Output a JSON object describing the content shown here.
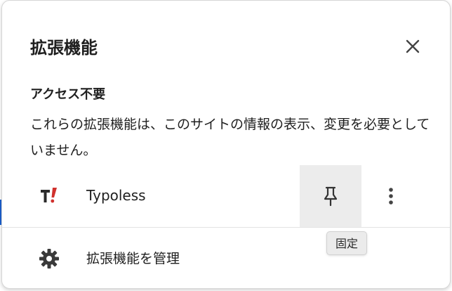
{
  "panel": {
    "title": "拡張機能",
    "close_icon": "close-icon"
  },
  "section": {
    "heading": "アクセス不要",
    "description": "これらの拡張機能は、このサイトの情報の表示、変更を必要としていません。"
  },
  "extension": {
    "name": "Typoless",
    "icon": "typoless-logo",
    "pin_icon": "pin-icon",
    "more_icon": "more-vertical-icon",
    "tooltip": "固定"
  },
  "manage": {
    "label": "拡張機能を管理",
    "icon": "gear-icon"
  },
  "colors": {
    "logo_dark": "#2b2b2b",
    "logo_red": "#d0312d",
    "pin_hover_bg": "#ececec"
  }
}
